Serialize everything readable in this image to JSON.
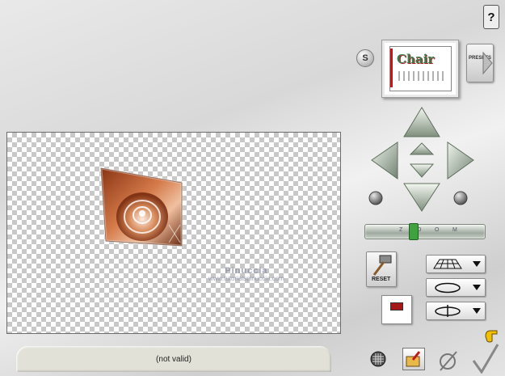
{
  "status": {
    "text": "(not valid)"
  },
  "preset": {
    "thumbnail_text": "Chair",
    "button_label": "PRESETS"
  },
  "buttons": {
    "s_label": "S",
    "help_label": "?",
    "reset_label": "RESET"
  },
  "zoom": {
    "label_letters": [
      "Z",
      "O",
      "O",
      "M"
    ]
  },
  "watermark": {
    "line1": "Pinuccia",
    "line2": "www.tutorialspinuccia.com"
  },
  "icons": {
    "help": "help-icon",
    "s": "s-button",
    "nav_up": "arrow-up-icon",
    "nav_down": "arrow-down-icon",
    "nav_left": "arrow-left-icon",
    "nav_right": "arrow-right-icon",
    "rotate_left": "rotate-left-icon",
    "rotate_right": "rotate-right-icon",
    "grid": "grid-icon",
    "apply": "apply-icon",
    "cancel": "cancel-icon",
    "ok": "checkmark-icon",
    "hand": "pointing-hand-icon"
  },
  "colors": {
    "accent_green": "#3fa23f",
    "status_bg": "#e1e1d8",
    "preview_border": "#6d6d6d"
  }
}
